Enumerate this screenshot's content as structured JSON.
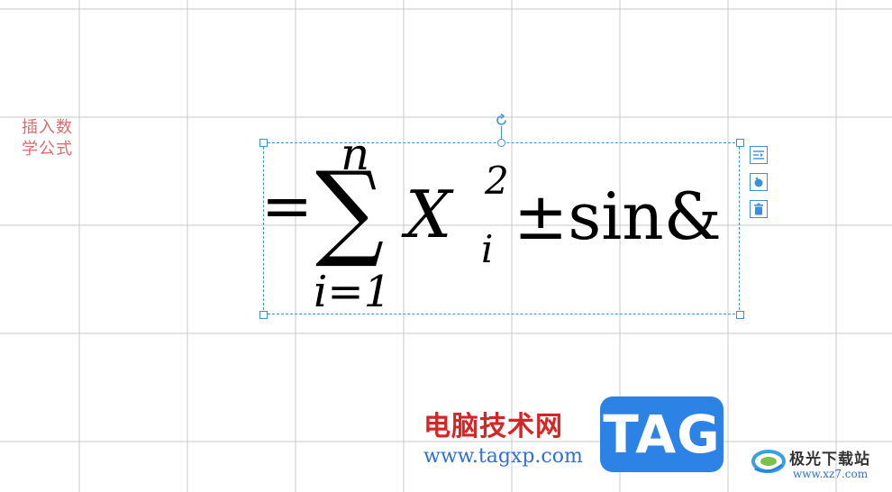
{
  "canvas": {
    "side_label_line1": "插入数",
    "side_label_line2": "学公式"
  },
  "equation": {
    "equals": "=",
    "sum_symbol": "∑",
    "upper_limit": "n",
    "lower_limit": "i=1",
    "variable": "X",
    "superscript": "2",
    "subscript": "i",
    "operator": "±",
    "function": "sin",
    "trailing": "&"
  },
  "equation_tools": {
    "layout_icon": "wrap-layout-icon",
    "rotate_icon": "rotate-icon",
    "delete_icon": "trash-icon"
  },
  "watermark": {
    "site_name": "电脑技术网",
    "url": "www.tagxp.com",
    "badge": "TAG",
    "xz_title": "极光下载站",
    "xz_url": "www.xz7.com"
  },
  "colors": {
    "selection": "#3d8edb",
    "side_label": "#e06a6a",
    "grid": "#c9c9c9",
    "tag_blue": "#2d82e6",
    "site_red": "#d72525"
  }
}
